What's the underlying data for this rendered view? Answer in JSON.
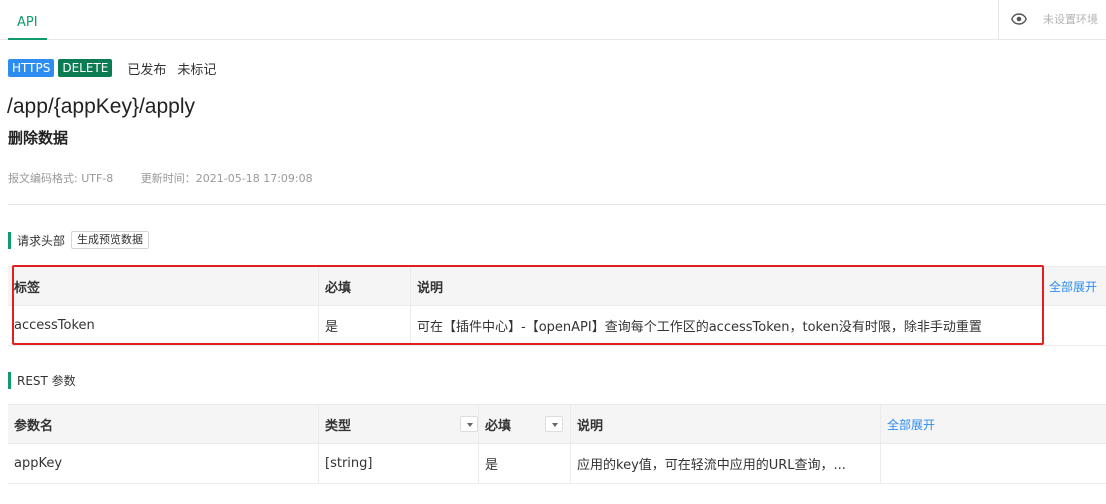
{
  "topbar": {
    "tab": "API",
    "env_label": "未设置环境"
  },
  "badges": {
    "protocol": "HTTPS",
    "method": "DELETE",
    "status": "已发布",
    "mark": "未标记"
  },
  "api": {
    "path": "/app/{appKey}/apply",
    "title": "删除数据",
    "encoding": "报文编码格式: UTF-8",
    "updated": "更新时间：2021-05-18 17:09:08"
  },
  "headers_section": {
    "title": "请求头部",
    "generate_button": "生成预览数据",
    "columns": [
      "标签",
      "必填",
      "说明"
    ],
    "expand_all": "全部展开",
    "rows": [
      {
        "tag": "accessToken",
        "required": "是",
        "desc": "可在【插件中心】-【openAPI】查询每个工作区的accessToken，token没有时限，除非手动重置"
      }
    ]
  },
  "rest_section": {
    "title": "REST 参数",
    "columns": [
      "参数名",
      "类型",
      "必填",
      "说明"
    ],
    "expand_all": "全部展开",
    "rows": [
      {
        "name": "appKey",
        "type": "[string]",
        "required": "是",
        "desc": "应用的key值，可在轻流中应用的URL查询，..."
      }
    ]
  },
  "colors": {
    "accent": "#0f9b6e",
    "https": "#2d8cf0",
    "delete": "#0a7b52",
    "highlight": "#e02020"
  }
}
